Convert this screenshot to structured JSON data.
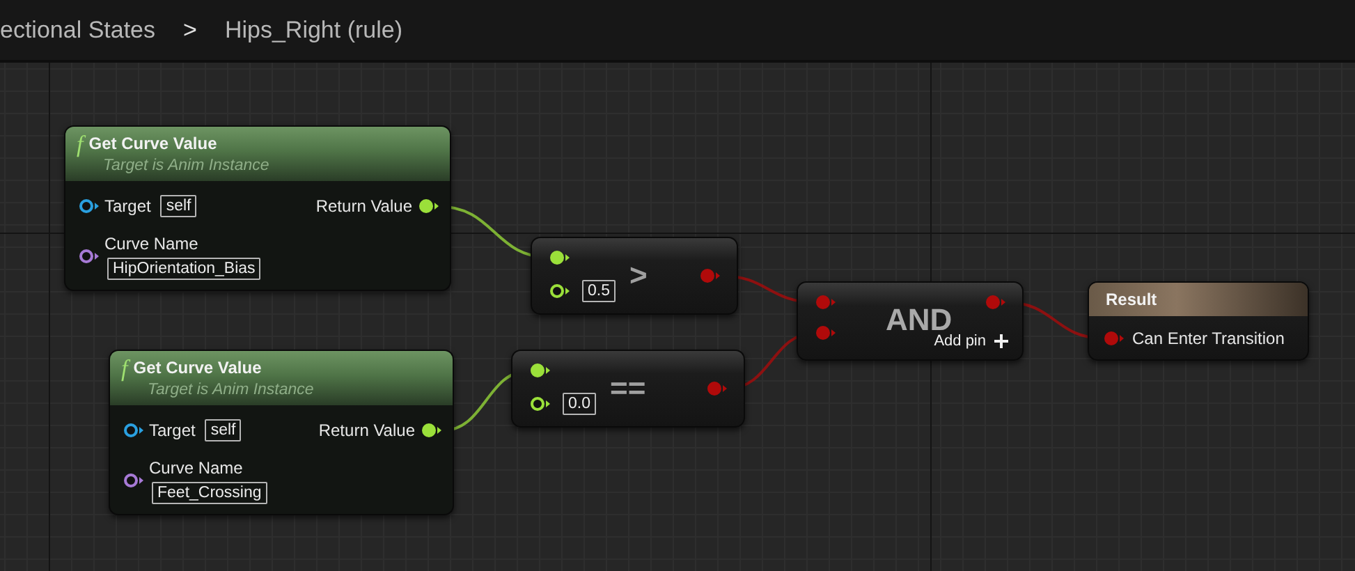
{
  "breadcrumb": {
    "items": [
      "ectional States",
      "Hips_Right (rule)"
    ],
    "separator": ">"
  },
  "nodes": [
    {
      "kind": "function",
      "icon": "f",
      "title": "Get Curve Value",
      "subtitle": "Target is Anim Instance",
      "inputs": [
        {
          "label": "Target",
          "value": "self",
          "connected": false,
          "color": "#2aa0e0"
        },
        {
          "label": "Curve Name",
          "value": "HipOrientation_Bias",
          "connected": false,
          "color": "#a77ad6"
        }
      ],
      "outputs": [
        {
          "label": "Return Value",
          "connected": true,
          "color": "#9be03a"
        }
      ]
    },
    {
      "kind": "function",
      "icon": "f",
      "title": "Get Curve Value",
      "subtitle": "Target is Anim Instance",
      "inputs": [
        {
          "label": "Target",
          "value": "self",
          "connected": false,
          "color": "#2aa0e0"
        },
        {
          "label": "Curve Name",
          "value": "Feet_Crossing",
          "connected": false,
          "color": "#a77ad6"
        }
      ],
      "outputs": [
        {
          "label": "Return Value",
          "connected": true,
          "color": "#9be03a"
        }
      ]
    },
    {
      "kind": "operator",
      "symbol": ">",
      "inputs": [
        {
          "connected": true,
          "color": "#9be03a"
        },
        {
          "value": "0.5",
          "connected": false,
          "color": "#9be03a"
        }
      ],
      "outputs": [
        {
          "connected": true,
          "color": "#b00a0a"
        }
      ]
    },
    {
      "kind": "operator",
      "symbol": "==",
      "inputs": [
        {
          "connected": true,
          "color": "#9be03a"
        },
        {
          "value": "0.0",
          "connected": false,
          "color": "#9be03a"
        }
      ],
      "outputs": [
        {
          "connected": true,
          "color": "#b00a0a"
        }
      ]
    },
    {
      "kind": "and",
      "title": "AND",
      "add_pin": "Add pin",
      "inputs": [
        {
          "connected": true,
          "color": "#b00a0a"
        },
        {
          "connected": true,
          "color": "#b00a0a"
        }
      ],
      "outputs": [
        {
          "connected": true,
          "color": "#b00a0a"
        }
      ]
    },
    {
      "kind": "result",
      "title": "Result",
      "inputs": [
        {
          "label": "Can Enter Transition",
          "connected": true,
          "color": "#b00a0a"
        }
      ]
    }
  ]
}
